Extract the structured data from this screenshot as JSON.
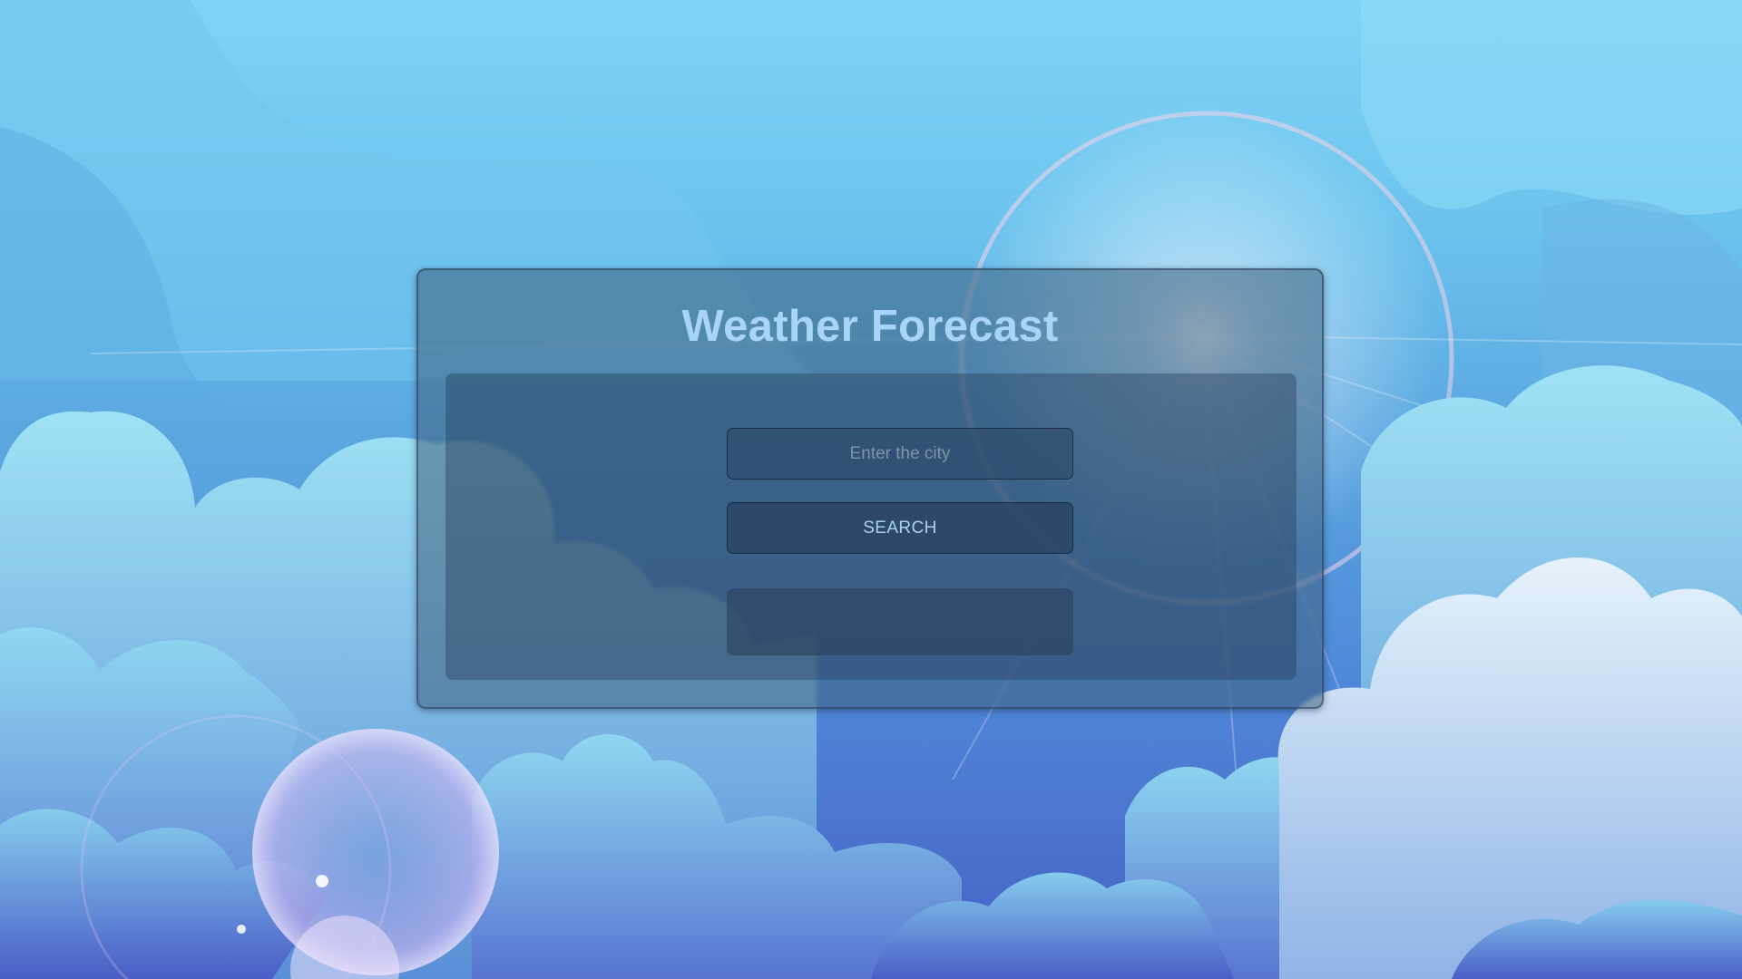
{
  "app": {
    "title": "Weather Forecast"
  },
  "search": {
    "city_value": "",
    "city_placeholder": "Enter the city",
    "button_label": "SEARCH"
  },
  "result": {
    "text": ""
  },
  "colors": {
    "title": "#a8d4f7",
    "sky_top": "#7fd3f6",
    "sky_bottom": "#4760c4",
    "card_bg": "#3e5e7c",
    "button_text": "#a9d2f2"
  },
  "icons": {
    "background": "cloudy-sky-illustration",
    "sun": "sun-lens-flare"
  }
}
